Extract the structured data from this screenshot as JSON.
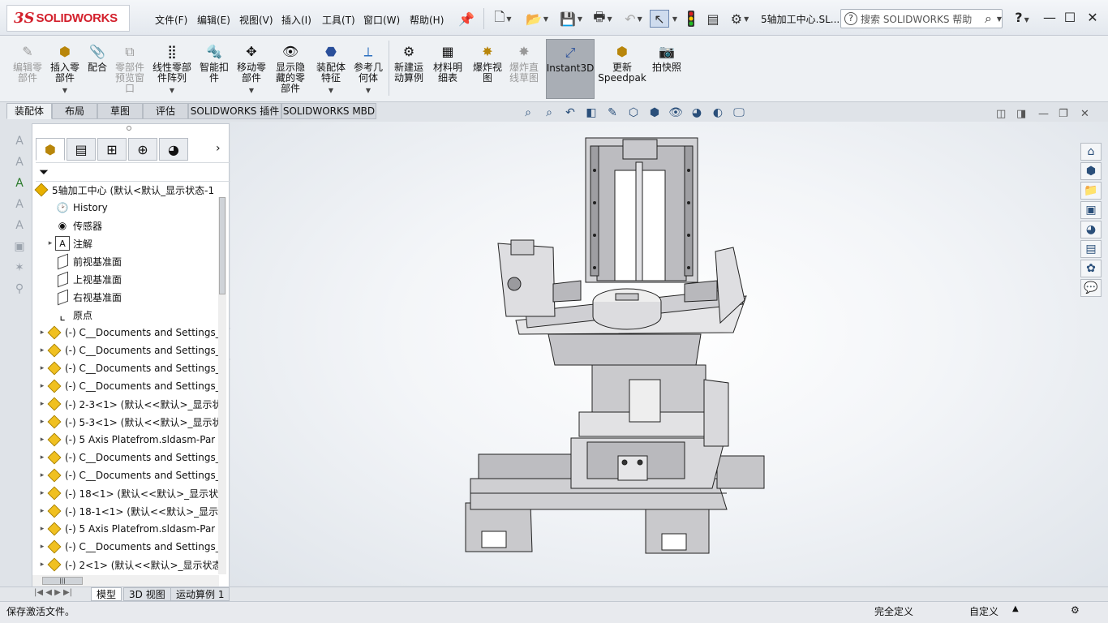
{
  "app": {
    "logo_ds": "3S",
    "logo_brand": "SOLIDWORKS"
  },
  "menu": [
    "文件(F)",
    "编辑(E)",
    "视图(V)",
    "插入(I)",
    "工具(T)",
    "窗口(W)",
    "帮助(H)"
  ],
  "doc_title": "5轴加工中心.SL...",
  "search": {
    "placeholder": "搜索 SOLIDWORKS 帮助",
    "help_mark": "?",
    "question": "?"
  },
  "ribbon": {
    "edit_component": "编辑零\n部件",
    "insert_components": "插入零\n部件",
    "mate": "配合",
    "component_preview": "零部件\n预览窗\n口",
    "linear_pattern": "线性零部\n件阵列",
    "smart_fasteners": "智能扣\n件",
    "move_component": "移动零\n部件",
    "show_hidden": "显示隐\n藏的零\n部件",
    "assembly_features": "装配体\n特征",
    "reference_geometry": "参考几\n何体",
    "new_motion_study": "新建运\n动算例",
    "bill_of_materials": "材料明\n细表",
    "exploded_view": "爆炸视\n图",
    "explode_line_sketch": "爆炸直\n线草图",
    "instant3d": "Instant3D",
    "update_speedpak": "更新\nSpeedpak",
    "take_snapshot": "拍快照"
  },
  "command_tabs": [
    "装配体",
    "布局",
    "草图",
    "评估",
    "SOLIDWORKS 插件",
    "SOLIDWORKS MBD"
  ],
  "feature_tree": {
    "root": "5轴加工中心 (默认<默认_显示状态-1",
    "items": [
      {
        "label": "History",
        "icon": "history-icon",
        "expand": ""
      },
      {
        "label": "传感器",
        "icon": "sensor-icon",
        "expand": ""
      },
      {
        "label": "注解",
        "icon": "annotation-icon",
        "expand": "▸"
      },
      {
        "label": "前视基准面",
        "icon": "plane-icon",
        "expand": ""
      },
      {
        "label": "上视基准面",
        "icon": "plane-icon",
        "expand": ""
      },
      {
        "label": "右视基准面",
        "icon": "plane-icon",
        "expand": ""
      },
      {
        "label": "原点",
        "icon": "origin-icon",
        "expand": ""
      },
      {
        "label": "(-) C__Documents and Settings_",
        "icon": "subassembly-icon",
        "expand": "▸"
      },
      {
        "label": "(-) C__Documents and Settings_",
        "icon": "subassembly-icon",
        "expand": "▸"
      },
      {
        "label": "(-) C__Documents and Settings_",
        "icon": "subassembly-icon",
        "expand": "▸"
      },
      {
        "label": "(-) C__Documents and Settings_",
        "icon": "subassembly-icon",
        "expand": "▸"
      },
      {
        "label": "(-) 2-3<1> (默认<<默认>_显示状",
        "icon": "subassembly-icon",
        "expand": "▸"
      },
      {
        "label": "(-) 5-3<1> (默认<<默认>_显示状",
        "icon": "subassembly-icon",
        "expand": "▸"
      },
      {
        "label": "(-) 5 Axis Platefrom.sldasm-Par",
        "icon": "subassembly-icon",
        "expand": "▸"
      },
      {
        "label": "(-) C__Documents and Settings_",
        "icon": "subassembly-icon",
        "expand": "▸"
      },
      {
        "label": "(-) C__Documents and Settings_",
        "icon": "subassembly-icon",
        "expand": "▸"
      },
      {
        "label": "(-) 18<1> (默认<<默认>_显示状",
        "icon": "subassembly-icon",
        "expand": "▸"
      },
      {
        "label": "(-) 18-1<1> (默认<<默认>_显示",
        "icon": "subassembly-icon",
        "expand": "▸"
      },
      {
        "label": "(-) 5 Axis Platefrom.sldasm-Par",
        "icon": "subassembly-icon",
        "expand": "▸"
      },
      {
        "label": "(-) C__Documents and Settings_",
        "icon": "subassembly-icon",
        "expand": "▸"
      },
      {
        "label": "(-) 2<1> (默认<<默认>_显示状态",
        "icon": "subassembly-icon",
        "expand": "▸"
      }
    ]
  },
  "bottom_tabs": [
    "模型",
    "3D 视图",
    "运动算例 1"
  ],
  "status": {
    "left": "保存激活文件。",
    "definition": "完全定义",
    "custom": "自定义"
  },
  "colors": {
    "accent": "#2a4f7a",
    "logo_red": "#d3202c",
    "instant3d_active": "#a9aeb5"
  }
}
